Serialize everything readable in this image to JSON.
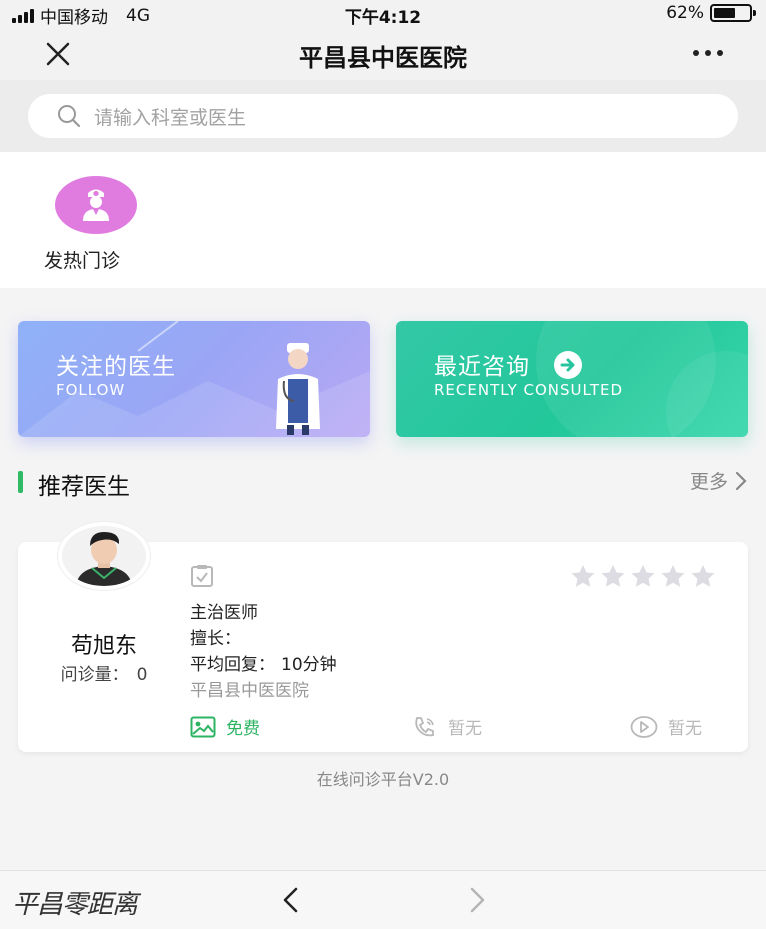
{
  "status_bar": {
    "carrier": "中国移动",
    "network": "4G",
    "time": "下午4:12",
    "battery": "62%",
    "battery_level": 0.62
  },
  "nav": {
    "title": "平昌县中医医院",
    "close_icon": "close-icon",
    "more_icon": "more-dots-icon"
  },
  "search": {
    "placeholder": "请输入科室或医生",
    "icon": "search-icon"
  },
  "quick_services": [
    {
      "label": "发热门诊",
      "icon": "doctor-icon",
      "color": "#e07be0"
    }
  ],
  "cards": {
    "follow": {
      "title": "关注的医生",
      "subtitle": "FOLLOW"
    },
    "recent": {
      "title": "最近咨询",
      "subtitle": "RECENTLY CONSULTED"
    }
  },
  "recommend": {
    "heading": "推荐医生",
    "more": "更多",
    "accent": "#2fba63"
  },
  "doctor": {
    "name": "苟旭东",
    "consult_label": "问诊量：",
    "consult_count": "0",
    "title": "主治医师",
    "skill_label": "擅长：",
    "reply_label": "平均回复：",
    "reply_value": "10分钟",
    "hospital": "平昌县中医医院",
    "rating": 0,
    "rating_max": 5,
    "services": {
      "image": "免费",
      "phone": "暂无",
      "video": "暂无"
    }
  },
  "footer": {
    "platform": "在线问诊平台V2.0"
  },
  "toolbar": {
    "watermark": "平昌零距离"
  }
}
